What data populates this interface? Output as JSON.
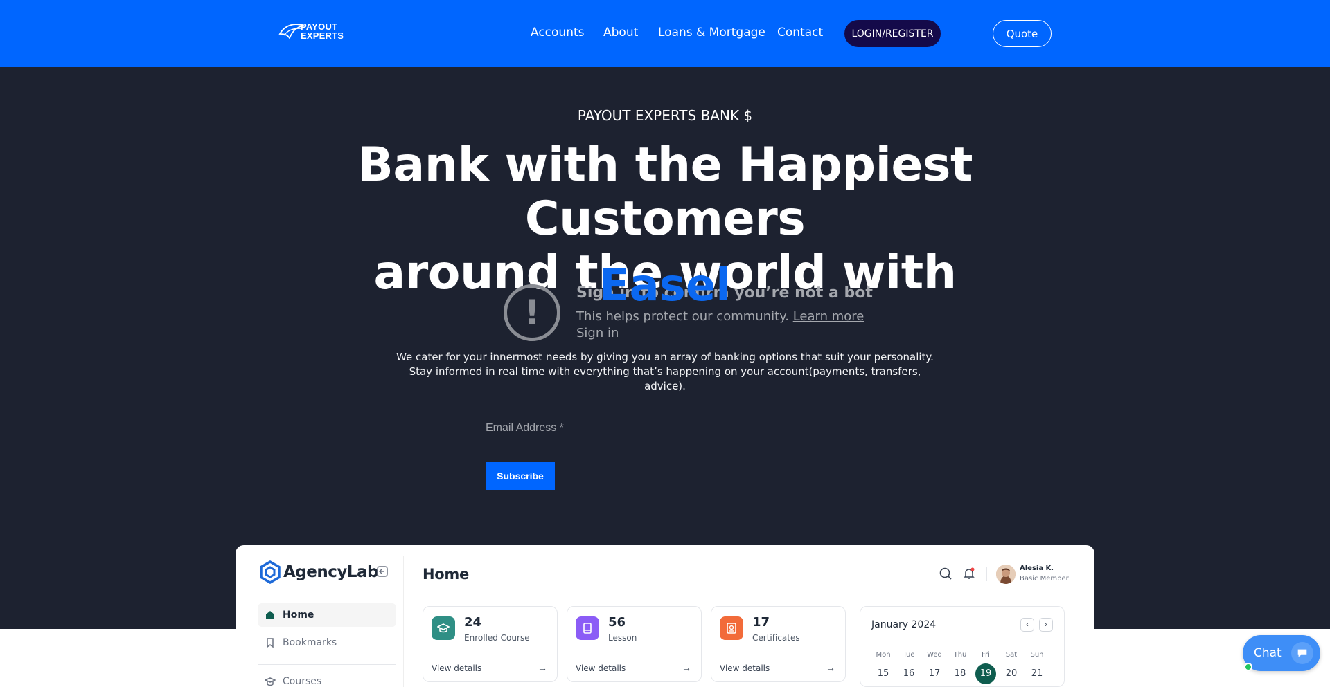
{
  "navbar": {
    "logo_line1": "PAYOUT",
    "logo_line2": "EXPERTS",
    "links": [
      "Accounts",
      "About",
      "Loans & Mortgage",
      "Contact"
    ],
    "login_label": "LOGIN/REGISTER",
    "quote_label": "Quote"
  },
  "hero": {
    "eyebrow": "PAYOUT EXPERTS BANK $",
    "headline_line1": "Bank with the Happiest Customers",
    "headline_line2": "around the world with",
    "highlight": "Easel",
    "description": "We cater for your innermost needs by giving you an array of banking options that suit your personality. Stay informed in real time with everything that’s happening on your account(payments, transfers, advice).",
    "email_placeholder": "Email Address *",
    "subscribe_label": "Subscribe"
  },
  "captcha": {
    "title": "Sign in to confirm you’re not a bot",
    "text": "This helps protect our community.",
    "learn_more": "Learn more",
    "sign_in": "Sign in"
  },
  "dashboard": {
    "app_name": "AgencyLab",
    "page_title": "Home",
    "sidebar": [
      {
        "label": "Home"
      },
      {
        "label": "Bookmarks"
      },
      {
        "label": "Courses"
      }
    ],
    "user": {
      "name": "Alesia K.",
      "role": "Basic Member"
    },
    "stats": [
      {
        "value": "24",
        "label": "Enrolled Course",
        "link": "View details",
        "color": "#2f8f85"
      },
      {
        "value": "56",
        "label": "Lesson",
        "link": "View details",
        "color": "#8b5cf6"
      },
      {
        "value": "17",
        "label": "Certificates",
        "link": "View details",
        "color": "#f26b3a"
      }
    ],
    "calendar": {
      "month": "January 2024",
      "weekdays": [
        "Mon",
        "Tue",
        "Wed",
        "Thu",
        "Fri",
        "Sat",
        "Sun"
      ],
      "days": [
        "15",
        "16",
        "17",
        "18",
        "19",
        "20",
        "21"
      ],
      "selected": "19"
    }
  },
  "chat": {
    "label": "Chat"
  },
  "colors": {
    "brand_blue": "#0066ff",
    "login_bg": "#140a4a",
    "hero_bg": "#1d2230",
    "highlight": "#0b68f0",
    "calendar_selected": "#0f5d4f"
  }
}
